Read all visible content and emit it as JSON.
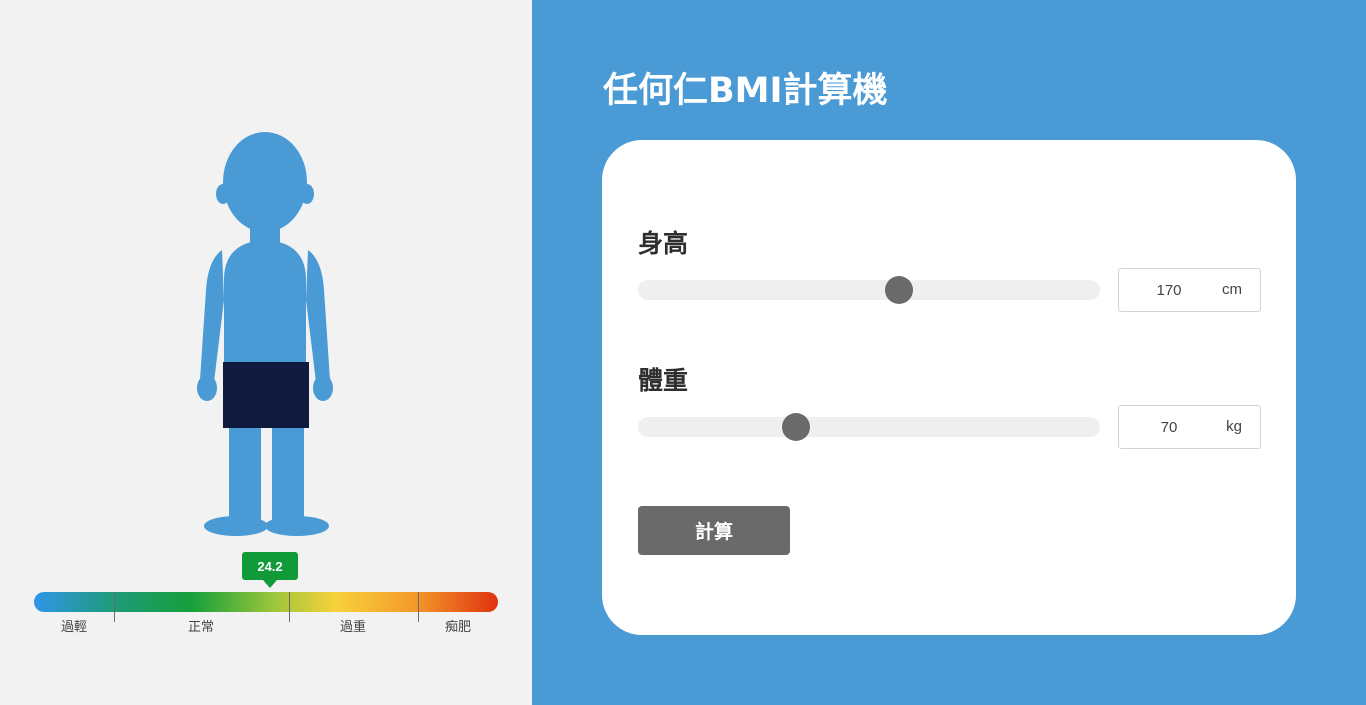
{
  "app": {
    "title": "任何仁BMI計算機"
  },
  "result": {
    "bmi": "24.2",
    "bmi_value": 24.2,
    "badge_color": "#119a38"
  },
  "scale": {
    "labels": [
      "過輕",
      "正常",
      "過重",
      "痴肥"
    ],
    "colors": [
      "#2f96e8",
      "#16a03b",
      "#f7d23a",
      "#e0320f"
    ]
  },
  "height": {
    "label": "身高",
    "value": "170",
    "unit": "cm",
    "fraction": 0.565
  },
  "weight": {
    "label": "體重",
    "value": "70",
    "unit": "kg",
    "fraction": 0.343
  },
  "actions": {
    "calculate_label": "計算"
  },
  "colors": {
    "accent": "#4a9ad6",
    "figure": "#4a9ad6",
    "shorts": "#0f1a3e",
    "button": "#6a6a6a",
    "panel_bg": "#f2f2f2"
  },
  "icons": {
    "figure": "person-figure-icon"
  }
}
